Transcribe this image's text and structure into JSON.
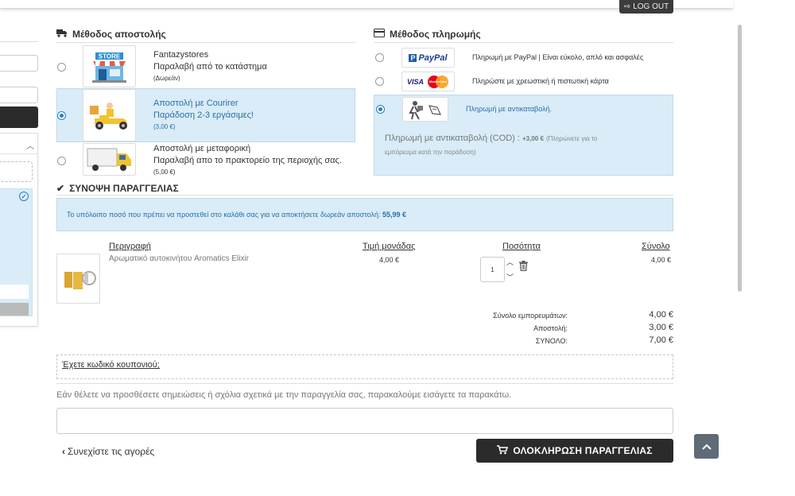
{
  "header": {
    "logout_label": "LOG OUT"
  },
  "shipping": {
    "title": "Μέθοδος αποστολής",
    "options": [
      {
        "name": "Fantazystores",
        "desc": "Παραλαβή από το κατάστημα",
        "price": "(Δωρεάν)",
        "selected": false,
        "image_text": "STORE"
      },
      {
        "name": "Αποστολή με Courirer",
        "desc": "Παράδοση 2-3 εργάσιμες!",
        "price": "(3,00 €)",
        "selected": true
      },
      {
        "name": "Αποστολή με μεταφορική",
        "desc": "Παραλαβή απο το πρακτορείο της περιοχής σας.",
        "price": "(5,00 €)",
        "selected": false
      }
    ]
  },
  "payment": {
    "title": "Μέθοδος πληρωμής",
    "options": [
      {
        "logo_text": "PayPal",
        "logo_prefix": "P",
        "text": "Πληρωμή με PayPal | Είναι εύκολο, απλό και ασφαλές",
        "selected": false
      },
      {
        "logo_text": "VISA",
        "logo_text2": "MasterCard",
        "text": "Πληρώστε με χρεωστική ή πιστωτική κάρτα",
        "selected": false
      },
      {
        "text": "Πληρωμή με αντικαταβολή.",
        "selected": true
      }
    ],
    "cod_title": "Πληρωμή με αντικαταβολή (COD) :",
    "cod_fee": "+3,00 €",
    "cod_note_line1": "(Πληρώνετε για το",
    "cod_note_line2": "εμπόρευμα κατά την παράδοση)"
  },
  "summary": {
    "title": "ΣΥΝΟΨΗ ΠΑΡΑΓΓΕΛΙΑΣ",
    "alert_text": "Το υπόλοιπο ποσό που πρέπει να προστεθεί στο καλάθι σας για να αποκτήσετε δωρεάν αποστολή:",
    "alert_amount": "55,99 €",
    "columns": {
      "description": "Περιγραφή",
      "unit_price": "Τιμή μονάδας",
      "quantity": "Ποσότητα",
      "total": "Σύνολο"
    },
    "item": {
      "name": "Αρωματικό αυτοκινήτου Aromatics Elixir",
      "unit_price": "4,00 €",
      "quantity": "1",
      "total": "4,00 €"
    },
    "totals": [
      {
        "label": "Σύνολο εμπορευμάτων:",
        "value": "4,00 €"
      },
      {
        "label": "Αποστολή:",
        "value": "3,00 €"
      },
      {
        "label": "ΣΥΝΟΛΟ:",
        "value": "7,00 €"
      }
    ]
  },
  "coupon": {
    "label": "Έχετε κωδικό κουπονιού;"
  },
  "notes": {
    "text": "Εάν θέλετε να προσθέσετε σημειώσεις ή σχόλια σχετικά με την παραγγελία σας, παρακαλούμε εισάγετε τα παρακάτω."
  },
  "actions": {
    "continue_label": "Συνεχίστε τις αγορές",
    "checkout_label": "ΟΛΟΚΛΗΡΩΣΗ ΠΑΡΑΓΓΕΛΙΑΣ"
  },
  "colors": {
    "accent_blue": "#2a7fc1",
    "highlight_bg": "#d9ecf7",
    "dark_button": "#2b2b2b"
  }
}
